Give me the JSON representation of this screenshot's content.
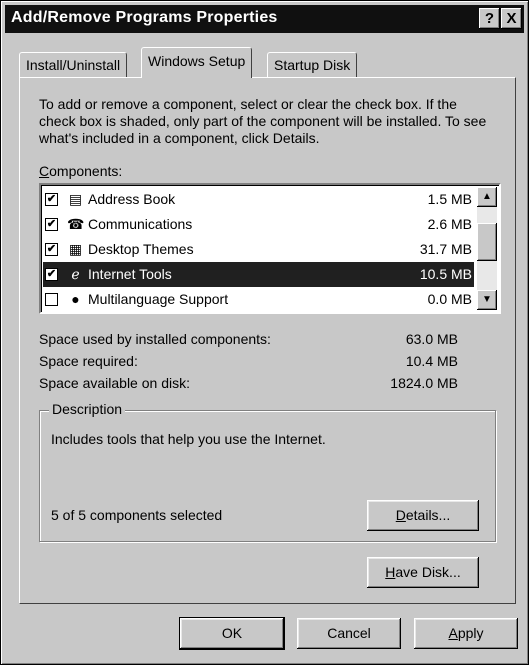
{
  "window": {
    "title": "Add/Remove Programs Properties"
  },
  "titlebar_buttons": {
    "help": "?",
    "close": "X"
  },
  "tabs": [
    {
      "label": "Install/Uninstall"
    },
    {
      "label": "Windows Setup"
    },
    {
      "label": "Startup Disk"
    }
  ],
  "intro": "To add or remove a component, select or clear the check box. If the check box is shaded, only part of the component will be installed. To see what's included in a component, click Details.",
  "components_label": "Components:",
  "components": [
    {
      "name": "Address Book",
      "size": "1.5 MB",
      "checked": true,
      "icon": "address-book-icon"
    },
    {
      "name": "Communications",
      "size": "2.6 MB",
      "checked": true,
      "icon": "communications-icon"
    },
    {
      "name": "Desktop Themes",
      "size": "31.7 MB",
      "checked": true,
      "icon": "desktop-themes-icon"
    },
    {
      "name": "Internet Tools",
      "size": "10.5 MB",
      "checked": true,
      "icon": "internet-tools-icon",
      "selected": true
    },
    {
      "name": "Multilanguage Support",
      "size": "0.0 MB",
      "checked": false,
      "icon": "globe-icon"
    }
  ],
  "stats": [
    {
      "label": "Space used by installed components:",
      "value": "63.0 MB"
    },
    {
      "label": "Space required:",
      "value": "10.4 MB"
    },
    {
      "label": "Space available on disk:",
      "value": "1824.0 MB"
    }
  ],
  "description": {
    "title": "Description",
    "text": "Includes tools that help you use the Internet.",
    "selected_count": "5 of 5 components selected",
    "details_button": "Details..."
  },
  "have_disk_button": "Have Disk...",
  "footer": {
    "ok": "OK",
    "cancel": "Cancel",
    "apply": "Apply"
  },
  "colors": {
    "face": "#c8c8c8",
    "titlebar": "#101010",
    "selection": "#202020"
  }
}
